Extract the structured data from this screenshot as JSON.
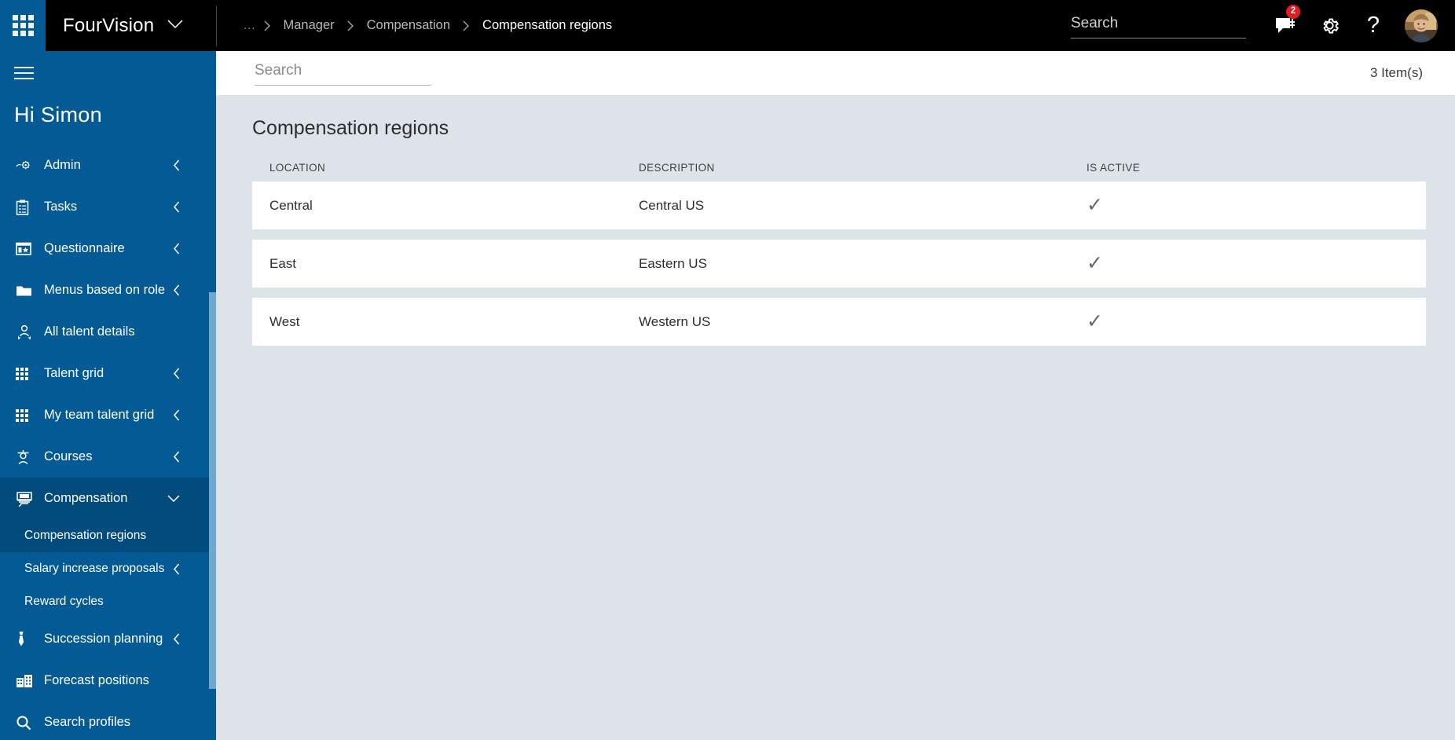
{
  "topbar": {
    "waffle_icon": "app-launcher-waffle-icon",
    "brand": "FourVision",
    "brand_chevron_icon": "chevron-down-icon",
    "breadcrumb": {
      "ellipsis": "...",
      "separator": "›",
      "items": [
        {
          "label": "Manager",
          "current": false
        },
        {
          "label": "Compensation",
          "current": false
        },
        {
          "label": "Compensation regions",
          "current": true
        }
      ]
    },
    "search": {
      "placeholder": "Search",
      "value": ""
    },
    "messages_icon": "message-icon",
    "messages_badge": "2",
    "settings_icon": "gear-icon",
    "help_icon": "question-mark-icon",
    "help_label": "?",
    "avatar_icon": "user-avatar"
  },
  "sidebar": {
    "hamburger_icon": "hamburger-menu-icon",
    "greeting": "Hi Simon",
    "items": [
      {
        "label": "Admin",
        "icon": "admin-gear-icon",
        "chevron": "‹",
        "expanded": false,
        "active": false
      },
      {
        "label": "Tasks",
        "icon": "clipboard-icon",
        "chevron": "‹",
        "expanded": false,
        "active": false
      },
      {
        "label": "Questionnaire",
        "icon": "questionnaire-icon",
        "chevron": "‹",
        "expanded": false,
        "active": false
      },
      {
        "label": "Menus based on role",
        "icon": "folder-icon",
        "chevron": "‹",
        "expanded": false,
        "active": false
      },
      {
        "label": "All talent details",
        "icon": "people-icon",
        "chevron": "",
        "expanded": false,
        "active": false
      },
      {
        "label": "Talent grid",
        "icon": "grid-icon",
        "chevron": "‹",
        "expanded": false,
        "active": false
      },
      {
        "label": "My team talent grid",
        "icon": "grid-icon",
        "chevron": "‹",
        "expanded": false,
        "active": false
      },
      {
        "label": "Courses",
        "icon": "graduation-person-icon",
        "chevron": "‹",
        "expanded": false,
        "active": false
      },
      {
        "label": "Compensation",
        "icon": "compensation-icon",
        "chevron": "∨",
        "expanded": true,
        "active": true
      }
    ],
    "sub_items": [
      {
        "label": "Compensation regions",
        "chevron": "",
        "active": true
      },
      {
        "label": "Salary increase proposals",
        "chevron": "‹",
        "active": false
      },
      {
        "label": "Reward cycles",
        "chevron": "",
        "active": false
      }
    ],
    "items_after": [
      {
        "label": "Succession planning",
        "icon": "tie-icon",
        "chevron": "‹",
        "active": false
      },
      {
        "label": "Forecast positions",
        "icon": "building-icon",
        "chevron": "",
        "active": false
      },
      {
        "label": "Search profiles",
        "icon": "search-icon",
        "chevron": "",
        "active": false
      }
    ]
  },
  "subbar": {
    "search": {
      "placeholder": "Search",
      "value": ""
    },
    "item_count": "3 Item(s)"
  },
  "main": {
    "title": "Compensation regions",
    "columns": [
      "LOCATION",
      "DESCRIPTION",
      "IS ACTIVE"
    ],
    "rows": [
      {
        "location": "Central",
        "description": "Central US",
        "is_active": "✓"
      },
      {
        "location": "East",
        "description": "Eastern US",
        "is_active": "✓"
      },
      {
        "location": "West",
        "description": "Western US",
        "is_active": "✓"
      }
    ]
  },
  "colors": {
    "brand_blue": "#035a95",
    "brand_blue_active": "#024b7d",
    "topbar_black": "#000000",
    "content_bg": "#dee3e9",
    "row_bg": "#ffffff",
    "badge_red": "#e31b23",
    "scrollbar_thumb": "#6fa8cf"
  }
}
